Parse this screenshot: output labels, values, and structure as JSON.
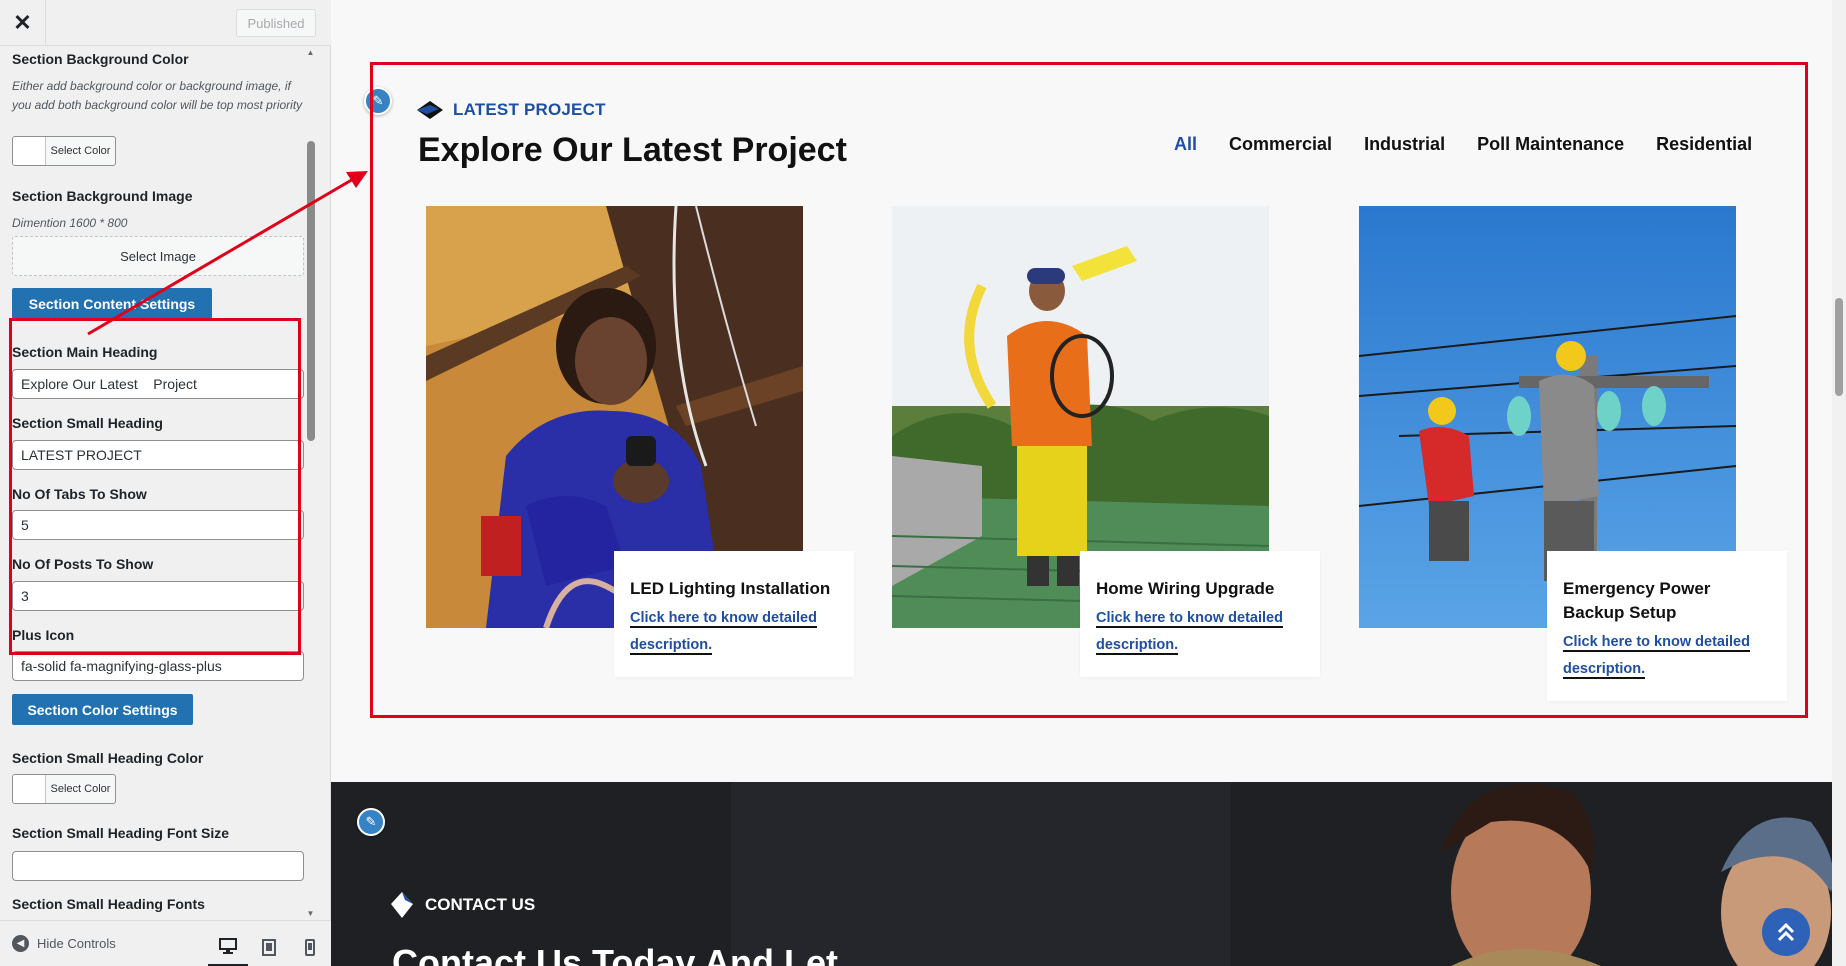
{
  "customizer": {
    "close_icon": "close-icon",
    "published_label": "Published",
    "controls": {
      "bg_color_title": "Section Background Color",
      "bg_color_desc": "Either add background color or background image, if you add both background color will be top most priority",
      "select_color_label": "Select Color",
      "bg_image_title": "Section Background Image",
      "bg_image_desc": "Dimention 1600 * 800",
      "select_image_label": "Select Image",
      "content_settings_label": "Section Content Settings",
      "main_heading_title": "Section Main Heading",
      "main_heading_value": "Explore Our Latest    Project",
      "small_heading_title": "Section Small Heading",
      "small_heading_value": "LATEST PROJECT",
      "tabs_title": "No Of Tabs To Show",
      "tabs_value": "5",
      "posts_title": "No Of Posts To Show",
      "posts_value": "3",
      "plus_icon_title": "Plus Icon",
      "plus_icon_value": "fa-solid fa-magnifying-glass-plus",
      "color_settings_label": "Section Color Settings",
      "small_heading_color_title": "Section Small Heading Color",
      "small_heading_color_btn": "Select Color",
      "small_heading_font_size_title": "Section Small Heading Font Size",
      "small_heading_font_size_value": "",
      "small_heading_fonts_title": "Section Small Heading Fonts"
    },
    "footer": {
      "hide_controls_label": "Hide Controls"
    }
  },
  "preview": {
    "project_section": {
      "small_heading": "LATEST PROJECT",
      "main_heading": "Explore Our Latest Project",
      "tabs": [
        {
          "label": "All",
          "active": true
        },
        {
          "label": "Commercial",
          "active": false
        },
        {
          "label": "Industrial",
          "active": false
        },
        {
          "label": "Poll Maintenance",
          "active": false
        },
        {
          "label": "Residential",
          "active": false
        }
      ],
      "cards": [
        {
          "title": "LED Lighting Installation",
          "link": "Click here to know detailed description."
        },
        {
          "title": "Home Wiring Upgrade",
          "link": "Click here to know detailed description."
        },
        {
          "title": "Emergency Power Backup Setup",
          "link": "Click here to know detailed description."
        }
      ]
    },
    "contact_section": {
      "small_heading": "CONTACT US",
      "main_heading": "Contact Us Today And Let"
    }
  },
  "colors": {
    "accent_blue": "#1e4fa3",
    "wp_blue": "#2271b1",
    "highlight_red": "#e0001a"
  }
}
